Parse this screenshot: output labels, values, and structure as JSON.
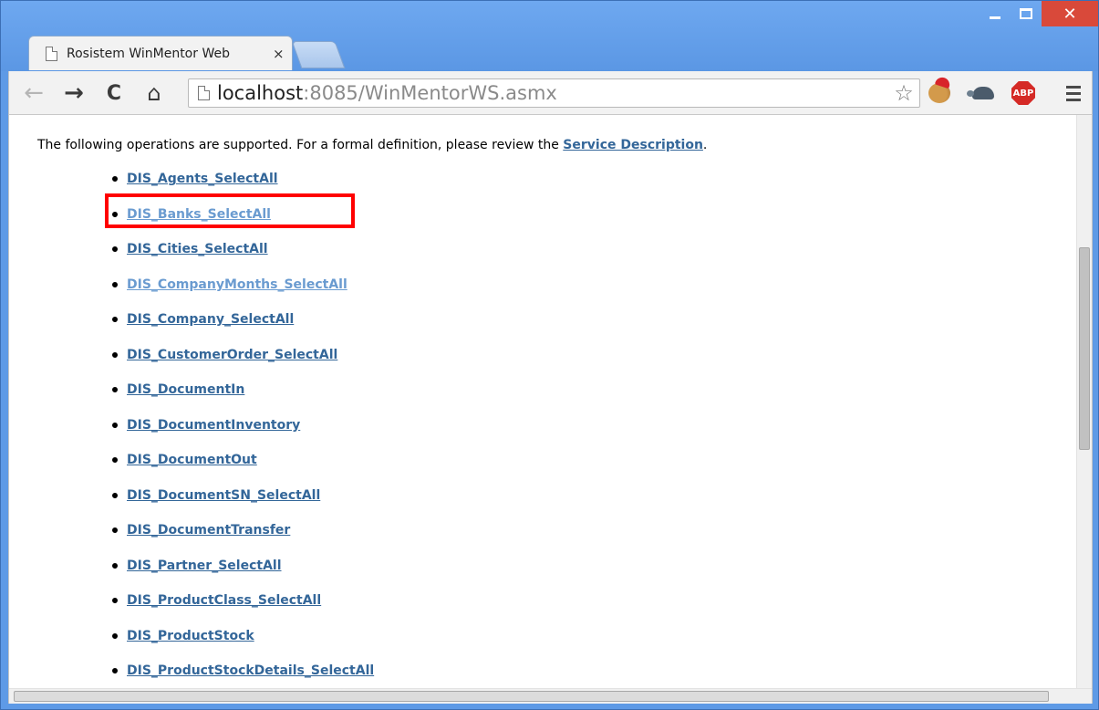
{
  "browser": {
    "tab": {
      "title": "Rosistem WinMentor Web",
      "close_glyph": "×"
    },
    "window_controls": {
      "close_glyph": "✕"
    },
    "address_bar": {
      "host": "localhost",
      "path": ":8085/WinMentorWS.asmx"
    },
    "nav": {
      "back": "←",
      "forward": "→",
      "reload": "C",
      "home": "⌂",
      "star": "☆"
    },
    "extensions": [
      {
        "name": "cookie-santa-icon"
      },
      {
        "name": "turtle-icon"
      },
      {
        "name": "adblock-plus-icon",
        "label": "ABP"
      }
    ]
  },
  "page": {
    "intro_text": "The following operations are supported. For a formal definition, please review the ",
    "service_description_link": "Service Description",
    "intro_suffix": ".",
    "operations": [
      {
        "label": "DIS_Agents_SelectAll",
        "visited": false
      },
      {
        "label": "DIS_Banks_SelectAll",
        "visited": true,
        "highlighted": true
      },
      {
        "label": "DIS_Cities_SelectAll",
        "visited": false
      },
      {
        "label": "DIS_CompanyMonths_SelectAll",
        "visited": true
      },
      {
        "label": "DIS_Company_SelectAll",
        "visited": false
      },
      {
        "label": "DIS_CustomerOrder_SelectAll",
        "visited": false
      },
      {
        "label": "DIS_DocumentIn",
        "visited": false
      },
      {
        "label": "DIS_DocumentInventory",
        "visited": false
      },
      {
        "label": "DIS_DocumentOut",
        "visited": false
      },
      {
        "label": "DIS_DocumentSN_SelectAll",
        "visited": false
      },
      {
        "label": "DIS_DocumentTransfer",
        "visited": false
      },
      {
        "label": "DIS_Partner_SelectAll",
        "visited": false
      },
      {
        "label": "DIS_ProductClass_SelectAll",
        "visited": false
      },
      {
        "label": "DIS_ProductStock",
        "visited": false
      },
      {
        "label": "DIS_ProductStockDetails_SelectAll",
        "visited": false
      }
    ]
  },
  "colors": {
    "link": "#336699",
    "visited_link": "#6a9bd0",
    "highlight": "#ff0000",
    "chrome_frame": "#5e9ae6"
  }
}
